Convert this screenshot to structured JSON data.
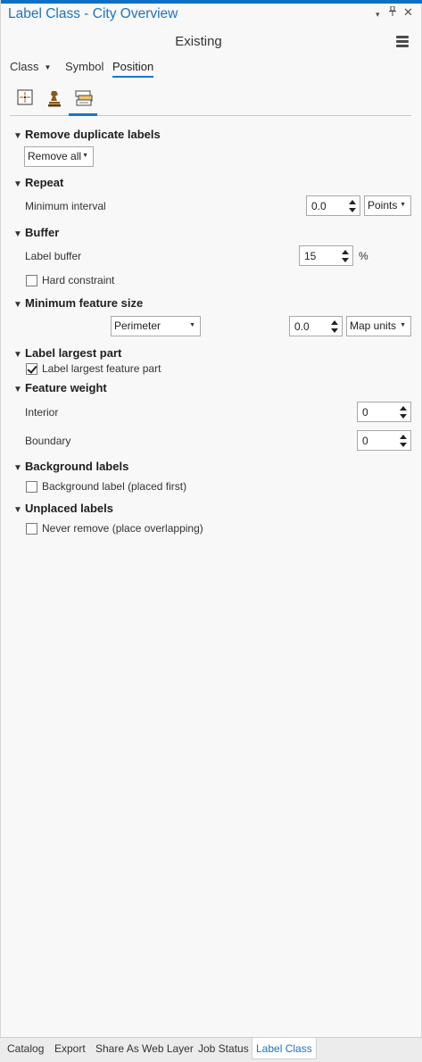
{
  "header": {
    "title": "Label Class - City Overview",
    "subtitle": "Existing",
    "controls": {
      "dropdown": "▾",
      "pin": "🖈",
      "close": "✕"
    }
  },
  "tabs": {
    "class_label": "Class",
    "symbol_label": "Symbol",
    "position_label": "Position",
    "active": "Position"
  },
  "subtabs": [
    "placement-properties-icon",
    "conflict-resolution-icon",
    "fitting-strategy-icon"
  ],
  "sections": {
    "remove_duplicates": {
      "title": "Remove duplicate labels",
      "value": "Remove all"
    },
    "repeat": {
      "title": "Repeat",
      "min_interval_label": "Minimum interval",
      "min_interval_value": "0.0",
      "unit": "Points"
    },
    "buffer": {
      "title": "Buffer",
      "label_buffer_label": "Label buffer",
      "label_buffer_value": "15",
      "unit": "%",
      "hard_constraint_label": "Hard constraint",
      "hard_constraint_checked": false
    },
    "min_feature_size": {
      "title": "Minimum feature size",
      "measure": "Perimeter",
      "value": "0.0",
      "unit": "Map units"
    },
    "label_largest": {
      "title": "Label largest part",
      "checkbox_label": "Label largest feature part",
      "checked": true
    },
    "feature_weight": {
      "title": "Feature weight",
      "interior_label": "Interior",
      "interior_value": "0",
      "boundary_label": "Boundary",
      "boundary_value": "0"
    },
    "background_labels": {
      "title": "Background labels",
      "checkbox_label": "Background label (placed first)",
      "checked": false
    },
    "unplaced_labels": {
      "title": "Unplaced labels",
      "checkbox_label": "Never remove (place overlapping)",
      "checked": false
    }
  },
  "bottom_tabs": [
    "Catalog",
    "Export",
    "Share As Web Layer",
    "Job Status",
    "Label Class"
  ],
  "bottom_tab_active": "Label Class",
  "colors": {
    "accent": "#1a75c2",
    "panel_bg": "#f8f8f8",
    "title_bar": "#0f6fc6"
  }
}
